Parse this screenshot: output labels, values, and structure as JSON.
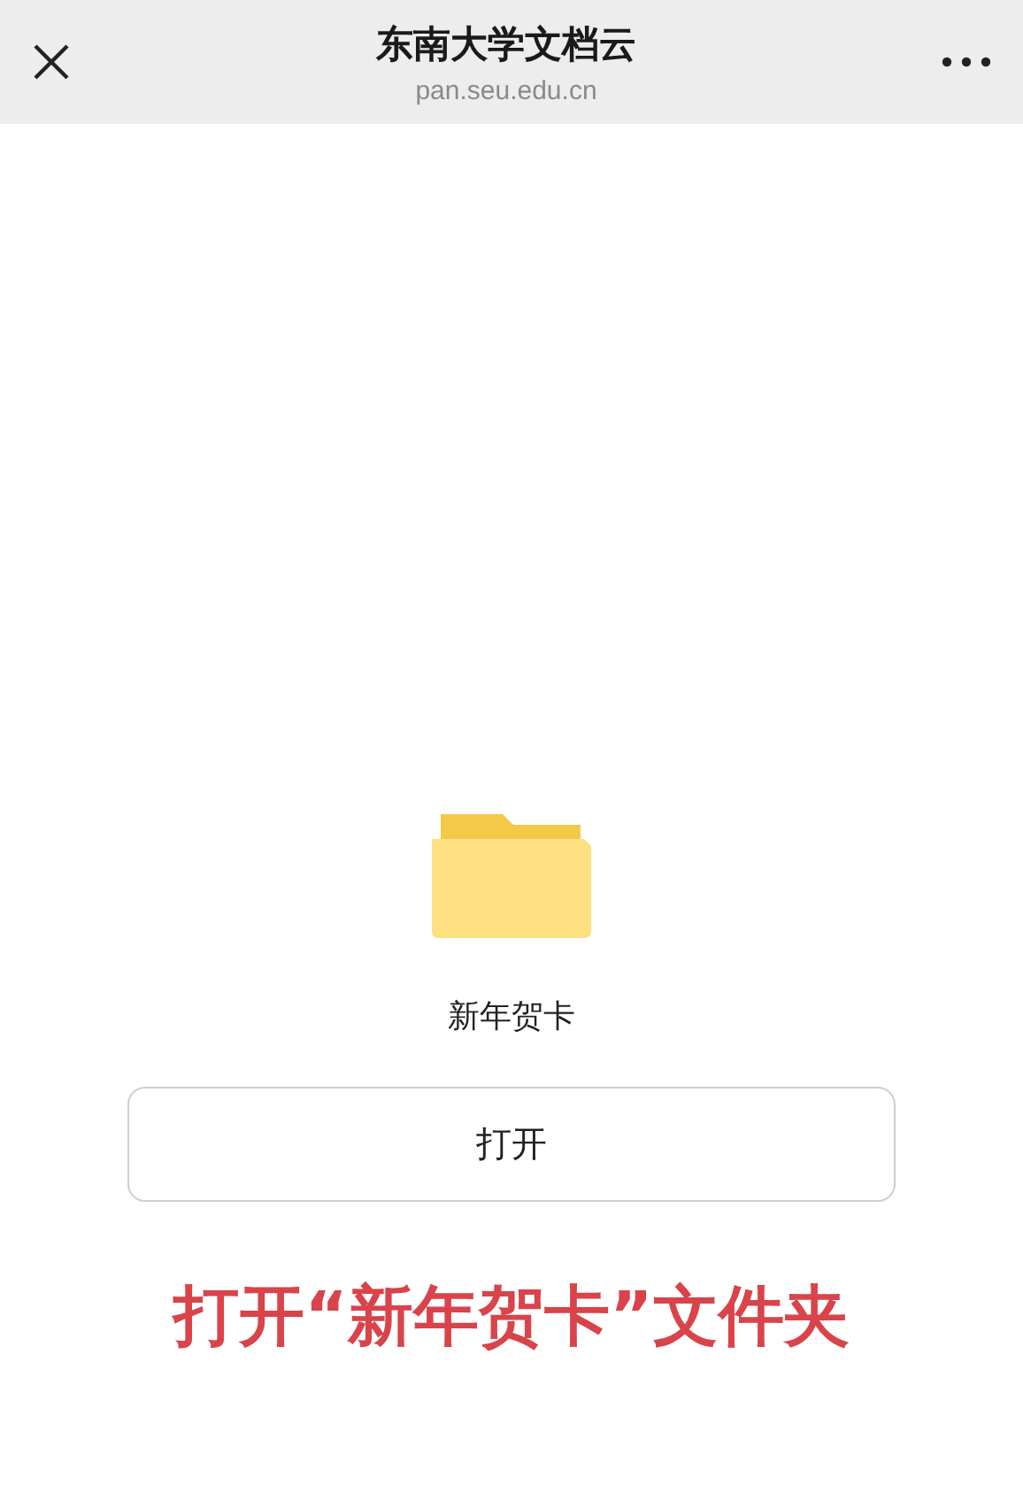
{
  "header": {
    "title": "东南大学文档云",
    "subtitle": "pan.seu.edu.cn"
  },
  "folder": {
    "name": "新年贺卡"
  },
  "button": {
    "label": "打开"
  },
  "caption": "打开“新年贺卡”文件夹"
}
